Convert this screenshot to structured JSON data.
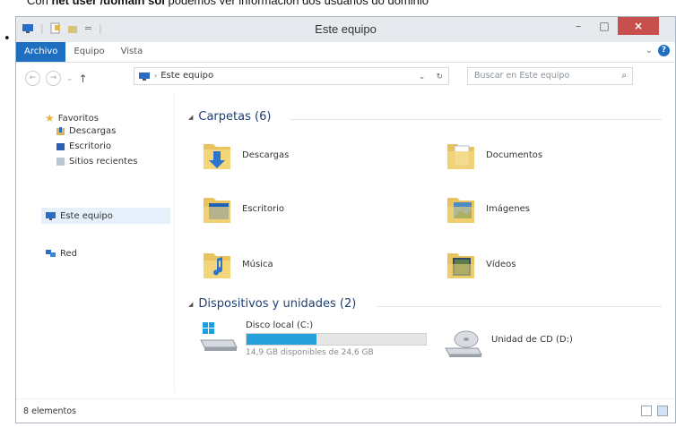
{
  "doc": {
    "pre": "Con ",
    "command": "net user /domain sol",
    "post": " podemos ver información dos usuarios do dominio"
  },
  "window": {
    "title": "Este equipo",
    "close_glyph": "×",
    "min_glyph": "–",
    "max_glyph": "□"
  },
  "ribbon": {
    "tabs": [
      "Archivo",
      "Equipo",
      "Vista"
    ]
  },
  "address": {
    "path": "Este equipo",
    "search_placeholder": "Buscar en Este equipo"
  },
  "sidebar": {
    "favorites_label": "Favoritos",
    "favorites": [
      "Descargas",
      "Escritorio",
      "Sitios recientes"
    ],
    "computer_label": "Este equipo",
    "network_label": "Red"
  },
  "groups": {
    "folders_title": "Carpetas (6)",
    "devices_title": "Dispositivos y unidades (2)"
  },
  "folders": [
    "Descargas",
    "Documentos",
    "Escritorio",
    "Imágenes",
    "Música",
    "Vídeos"
  ],
  "drives": {
    "local": {
      "name": "Disco local (C:)",
      "free_text": "14,9 GB disponibles de 24,6 GB",
      "used_fraction": 0.39
    },
    "cd": {
      "name": "Unidad de CD (D:)"
    }
  },
  "status": {
    "count": "8 elementos"
  },
  "colors": {
    "accent": "#1e6fbf",
    "close": "#c7504c",
    "bar_fill": "#26a0da"
  }
}
